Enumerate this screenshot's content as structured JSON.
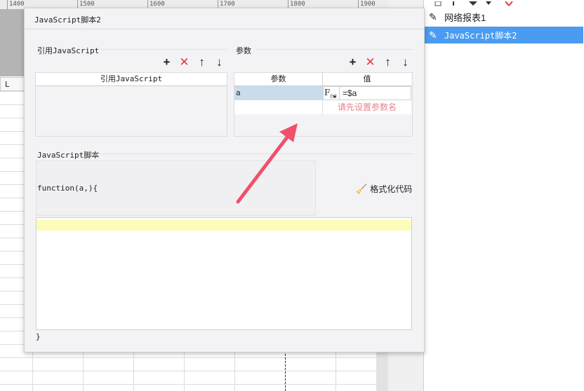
{
  "ruler": {
    "ticks": [
      "1400",
      "1500",
      "1600",
      "1700",
      "1800",
      "1900"
    ]
  },
  "sheet": {
    "col_header": "L"
  },
  "right_panel": {
    "items": [
      {
        "label": "网络报表1",
        "icon": "pencil-icon",
        "selected": false
      },
      {
        "label": "JavaScript脚本2",
        "icon": "pencil-icon",
        "selected": true
      }
    ]
  },
  "dialog": {
    "title": "JavaScript脚本2",
    "ref_section": {
      "label": "引用JavaScript",
      "column_header": "引用JavaScript"
    },
    "params_section": {
      "label": "参数",
      "columns": [
        "参数",
        "值"
      ],
      "rows": [
        {
          "name": "a",
          "value": "=$a"
        }
      ],
      "placeholder": "请先设置参数名"
    },
    "script_section": {
      "label": "JavaScript脚本",
      "signature": "function(a,){",
      "format_button": "格式化代码",
      "closing": "}"
    }
  },
  "colors": {
    "selection": "#4a9cf0",
    "delete": "#e23b3b",
    "placeholder": "#e9828a",
    "annotation_arrow": "#f0506a",
    "editor_highlight": "#fefcb9"
  }
}
